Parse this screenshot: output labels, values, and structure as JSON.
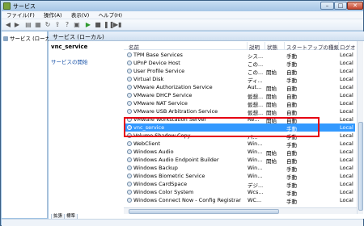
{
  "title": "サービス",
  "menu": [
    "ファイル(F)",
    "操作(A)",
    "表示(V)",
    "ヘルプ(H)"
  ],
  "tree": {
    "item": "サービス (ローカル)"
  },
  "header": {
    "title": "サービス (ローカル)"
  },
  "detail": {
    "service_name": "vnc_service",
    "start_link": "サービスの開始"
  },
  "columns": {
    "name": "名前",
    "desc": "説明",
    "state": "状態",
    "start": "スタートアップの種類",
    "logon": "ログオン"
  },
  "rows": [
    {
      "name": "TPM Base Services",
      "desc": "シス...",
      "state": "",
      "start": "手動",
      "logon": "Local"
    },
    {
      "name": "UPnP Device Host",
      "desc": "この...",
      "state": "",
      "start": "手動",
      "logon": "Local"
    },
    {
      "name": "User Profile Service",
      "desc": "この...",
      "state": "開始",
      "start": "自動",
      "logon": "Local"
    },
    {
      "name": "Virtual Disk",
      "desc": "ディ...",
      "state": "",
      "start": "手動",
      "logon": "Local"
    },
    {
      "name": "VMware Authorization Service",
      "desc": "Aut...",
      "state": "開始",
      "start": "自動",
      "logon": "Local"
    },
    {
      "name": "VMware DHCP Service",
      "desc": "仮想...",
      "state": "開始",
      "start": "自動",
      "logon": "Local"
    },
    {
      "name": "VMware NAT Service",
      "desc": "仮想...",
      "state": "開始",
      "start": "自動",
      "logon": "Local"
    },
    {
      "name": "VMware USB Arbitration Service",
      "desc": "仮想...",
      "state": "開始",
      "start": "自動",
      "logon": "Local"
    },
    {
      "name": "VMware Workstation Server",
      "desc": "Re...",
      "state": "開始",
      "start": "自動",
      "logon": "Local"
    },
    {
      "name": "vnc_service",
      "desc": "",
      "state": "",
      "start": "手動",
      "logon": "Local",
      "selected": true
    },
    {
      "name": "Volume Shadow Copy",
      "desc": "バ...",
      "state": "",
      "start": "手動",
      "logon": "Local"
    },
    {
      "name": "WebClient",
      "desc": "Win...",
      "state": "",
      "start": "手動",
      "logon": "Local"
    },
    {
      "name": "Windows Audio",
      "desc": "Win...",
      "state": "開始",
      "start": "自動",
      "logon": "Local"
    },
    {
      "name": "Windows Audio Endpoint Builder",
      "desc": "Win...",
      "state": "開始",
      "start": "自動",
      "logon": "Local"
    },
    {
      "name": "Windows Backup",
      "desc": "Win...",
      "state": "",
      "start": "手動",
      "logon": "Local"
    },
    {
      "name": "Windows Biometric Service",
      "desc": "Win...",
      "state": "",
      "start": "手動",
      "logon": "Local"
    },
    {
      "name": "Windows CardSpace",
      "desc": "デジ...",
      "state": "",
      "start": "手動",
      "logon": "Local"
    },
    {
      "name": "Windows Color System",
      "desc": "Wcs...",
      "state": "",
      "start": "手動",
      "logon": "Local"
    },
    {
      "name": "Windows Connect Now - Config Registrar",
      "desc": "WC...",
      "state": "",
      "start": "手動",
      "logon": "Local"
    }
  ],
  "tabs": [
    "拡張",
    "標準"
  ]
}
